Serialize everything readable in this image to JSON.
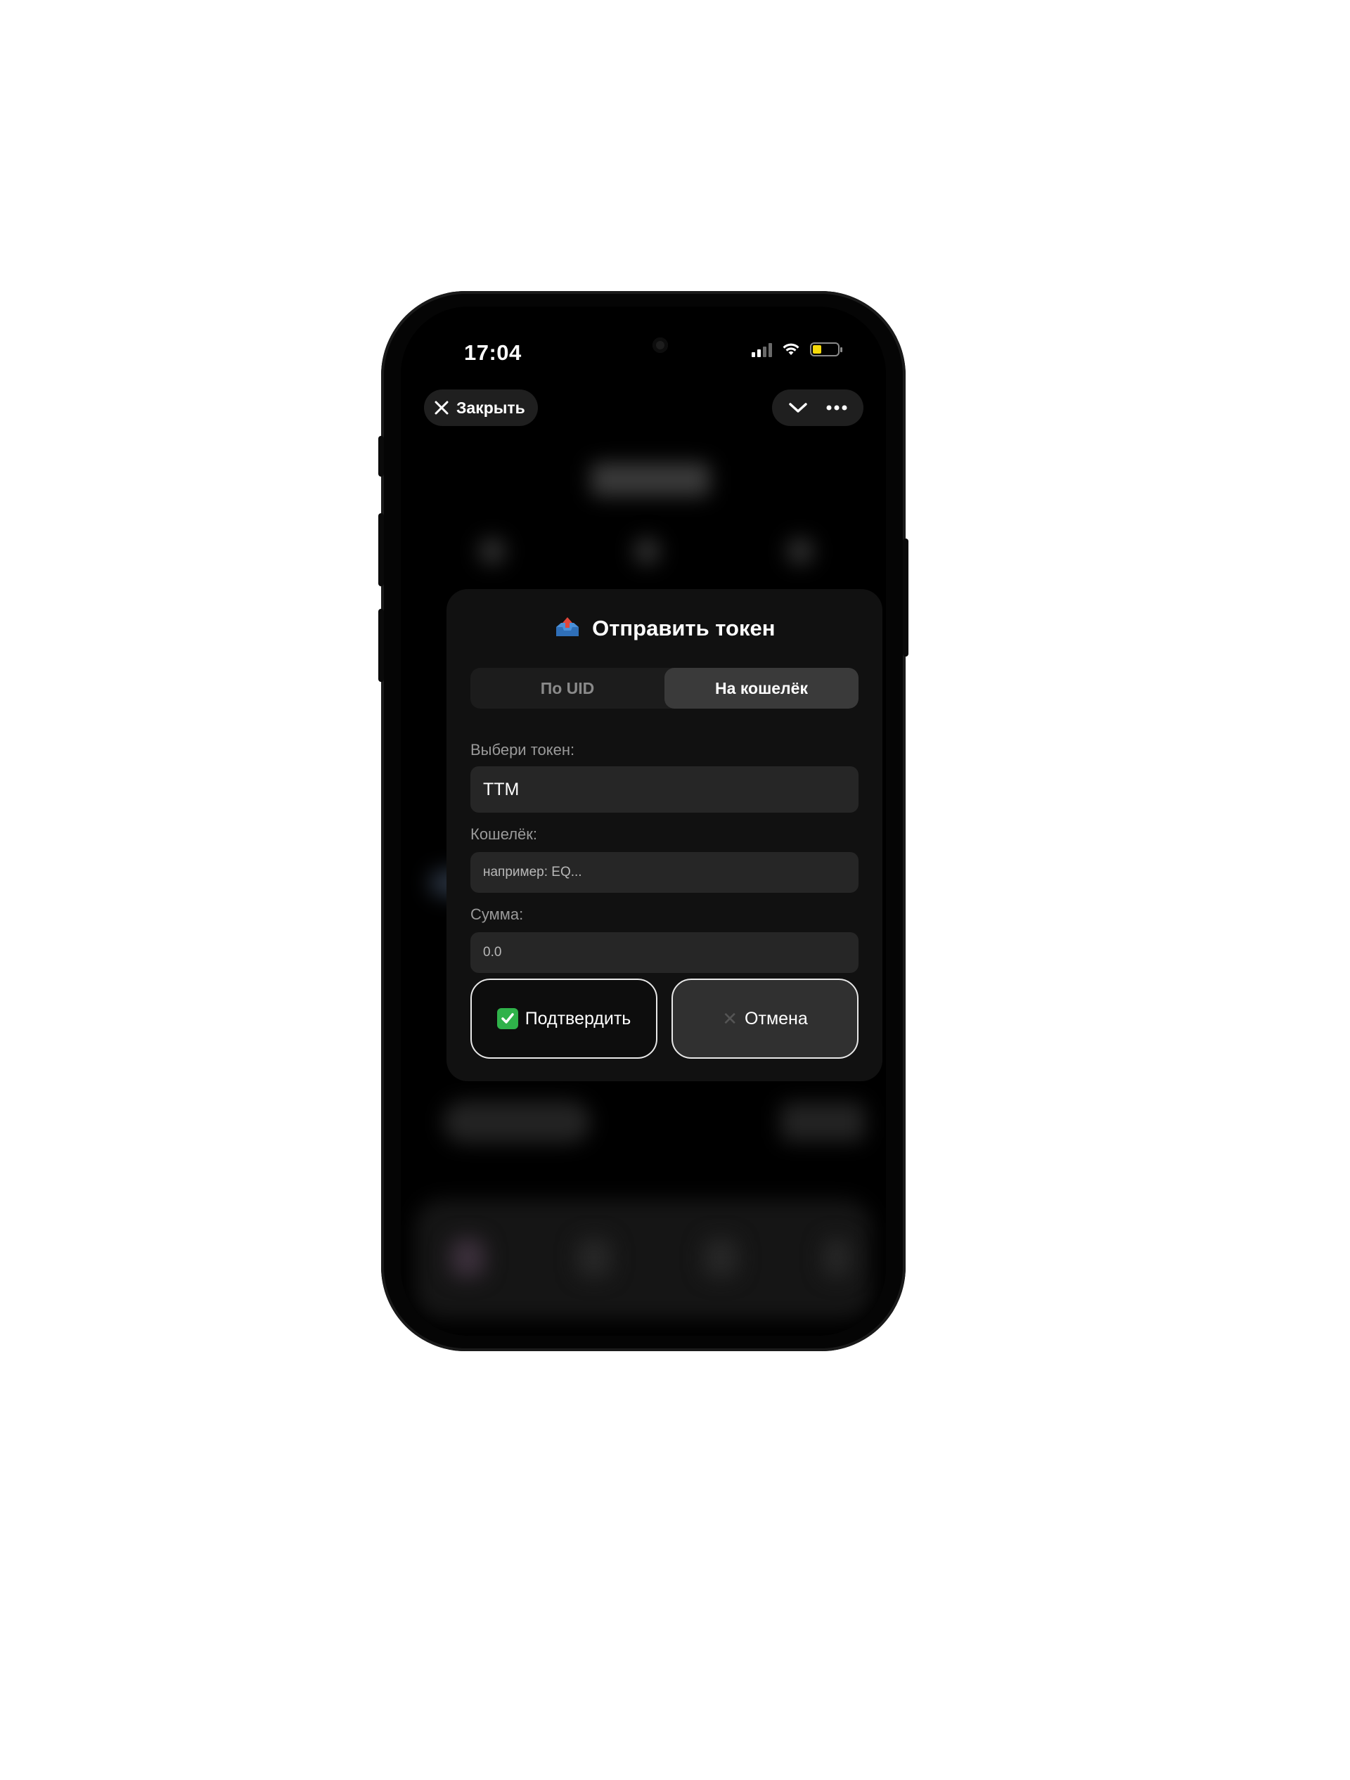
{
  "status_bar": {
    "time": "17:04"
  },
  "nav": {
    "close_label": "Закрыть"
  },
  "modal": {
    "title": "Отправить токен",
    "tabs": [
      {
        "label": "По UID",
        "active": false
      },
      {
        "label": "На кошелёк",
        "active": true
      }
    ],
    "token_label": "Выбери токен:",
    "token_value": "TTM",
    "wallet_label": "Кошелёк:",
    "wallet_placeholder": "например: EQ...",
    "amount_label": "Сумма:",
    "amount_placeholder": "0.0",
    "confirm_label": "Подтвердить",
    "cancel_label": "Отмена"
  },
  "colors": {
    "background": "#000000",
    "modal": "#111111",
    "field": "#262626",
    "active_tab": "#3a3a3a",
    "battery": "#f5d90a",
    "confirm_check": "#2fb24a"
  }
}
